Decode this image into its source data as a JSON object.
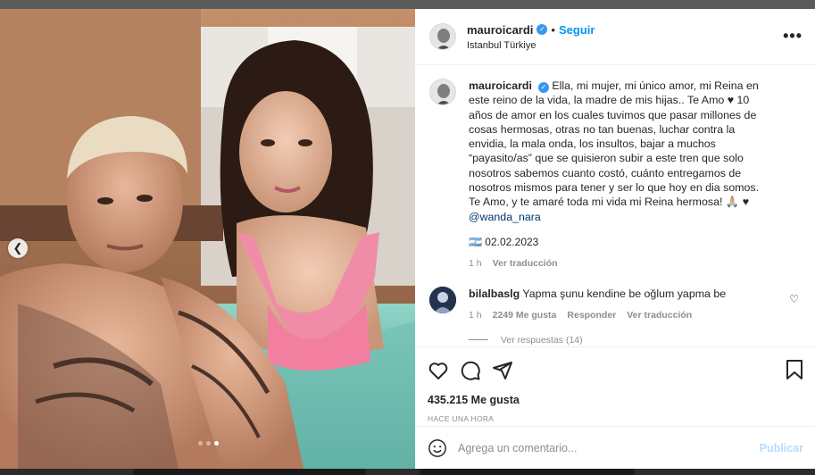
{
  "post": {
    "author": "mauroicardi",
    "follow_label": "Seguir",
    "separator": "•",
    "location": "Istanbul Türkiye",
    "more_label": "•••",
    "caption_text": "Ella, mi mujer, mi único amor, mi Reina en este reino de la vida, la madre de mis hijas.. Te Amo ♥ 10 años de amor en los cuales tuvimos que pasar millones de cosas hermosas, otras no tan buenas, luchar contra la envidia, la mala onda, los insultos, bajar a muchos “payasito/as” que se quisieron subir a este tren que solo nosotros sabemos cuanto costó, cuánto entregamos de nosotros mismos para tener y ser lo que hoy en dia somos. Te Amo, y te amaré toda mi vida mi Reina hermosa! 🙏🏼 ♥ ",
    "caption_mention": "@wanda_nara",
    "date_line": "🇦🇷 02.02.2023",
    "caption_meta": {
      "age": "1 h",
      "translate": "Ver traducción"
    }
  },
  "comment": {
    "author": "bilalbaslg",
    "text": "Yapma şunu kendine be oğlum yapma be",
    "age": "1 h",
    "likes": "2249 Me gusta",
    "reply": "Responder",
    "translate": "Ver traducción",
    "view_replies": "Ver respuestas (14)"
  },
  "stats": {
    "likes": "435.215 Me gusta",
    "time": "HACE UNA HORA"
  },
  "composer": {
    "placeholder": "Agrega un comentario...",
    "publish": "Publicar"
  },
  "carousel": {
    "current": 3,
    "total": 3,
    "prev_icon": "chevron-left-icon"
  },
  "colors": {
    "accent": "#0095f6",
    "publish_disabled": "#b3dbff",
    "muted": "#8e8e8e"
  }
}
